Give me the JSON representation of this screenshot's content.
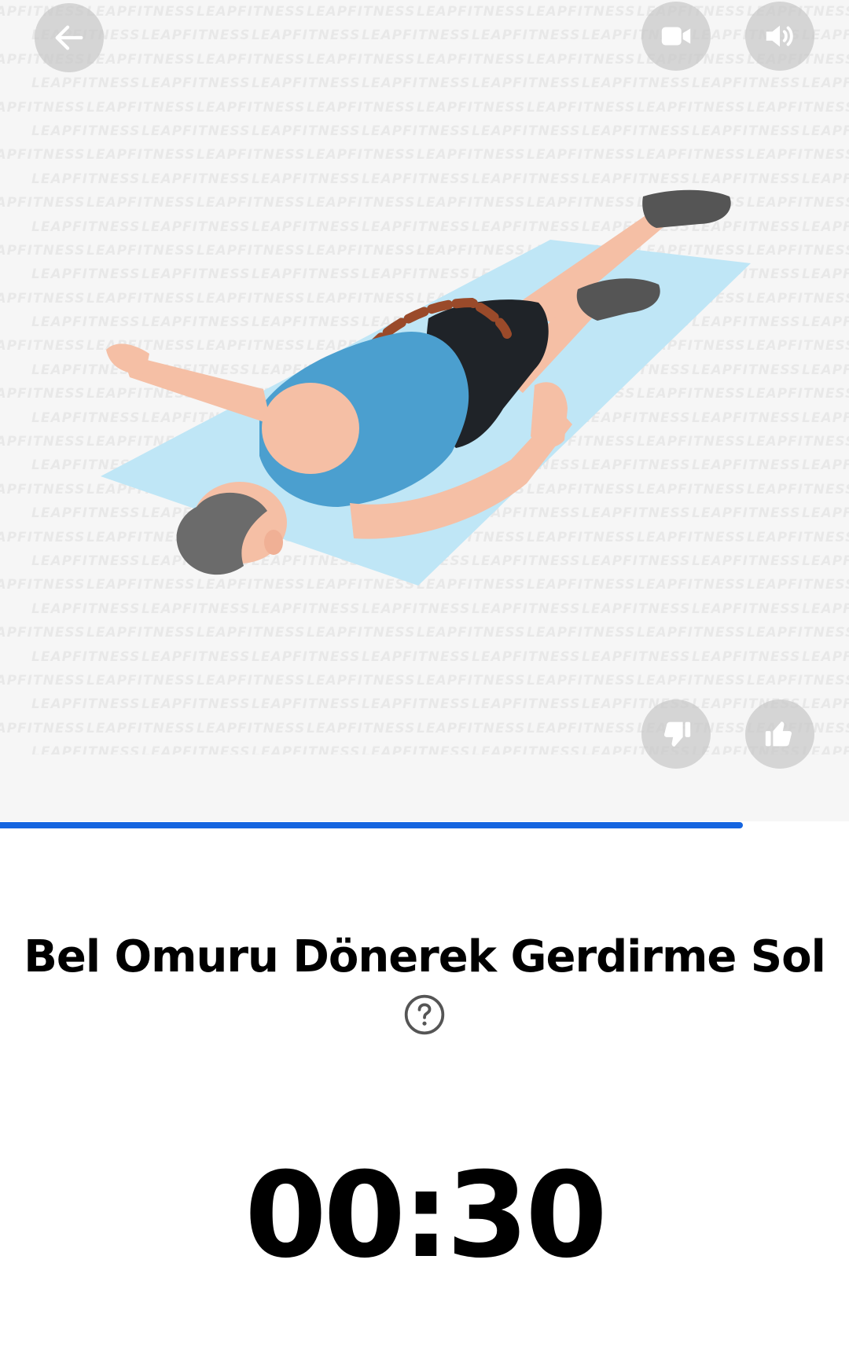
{
  "watermark": {
    "text": "LEAPFITNESS"
  },
  "illustration": {
    "mat_color": "#bfe6f6",
    "shirt_color": "#4b9fcf",
    "shorts_color": "#1f2328",
    "skin_color": "#f5bfa5",
    "hair_color": "#6b6b6b",
    "shoe_color": "#555555"
  },
  "buttons": {
    "back": {
      "icon": "arrow-left-icon"
    },
    "video": {
      "icon": "video-camera-icon"
    },
    "sound": {
      "icon": "speaker-icon"
    },
    "dislike": {
      "icon": "thumbs-down-icon"
    },
    "like": {
      "icon": "thumbs-up-icon"
    }
  },
  "progress": {
    "fraction": 0.875,
    "color": "#1565e0"
  },
  "exercise": {
    "title": "Bel Omuru Dönerek Gerdirme Sol",
    "help_icon": "question-circle-icon"
  },
  "timer": {
    "value": "00:30"
  }
}
